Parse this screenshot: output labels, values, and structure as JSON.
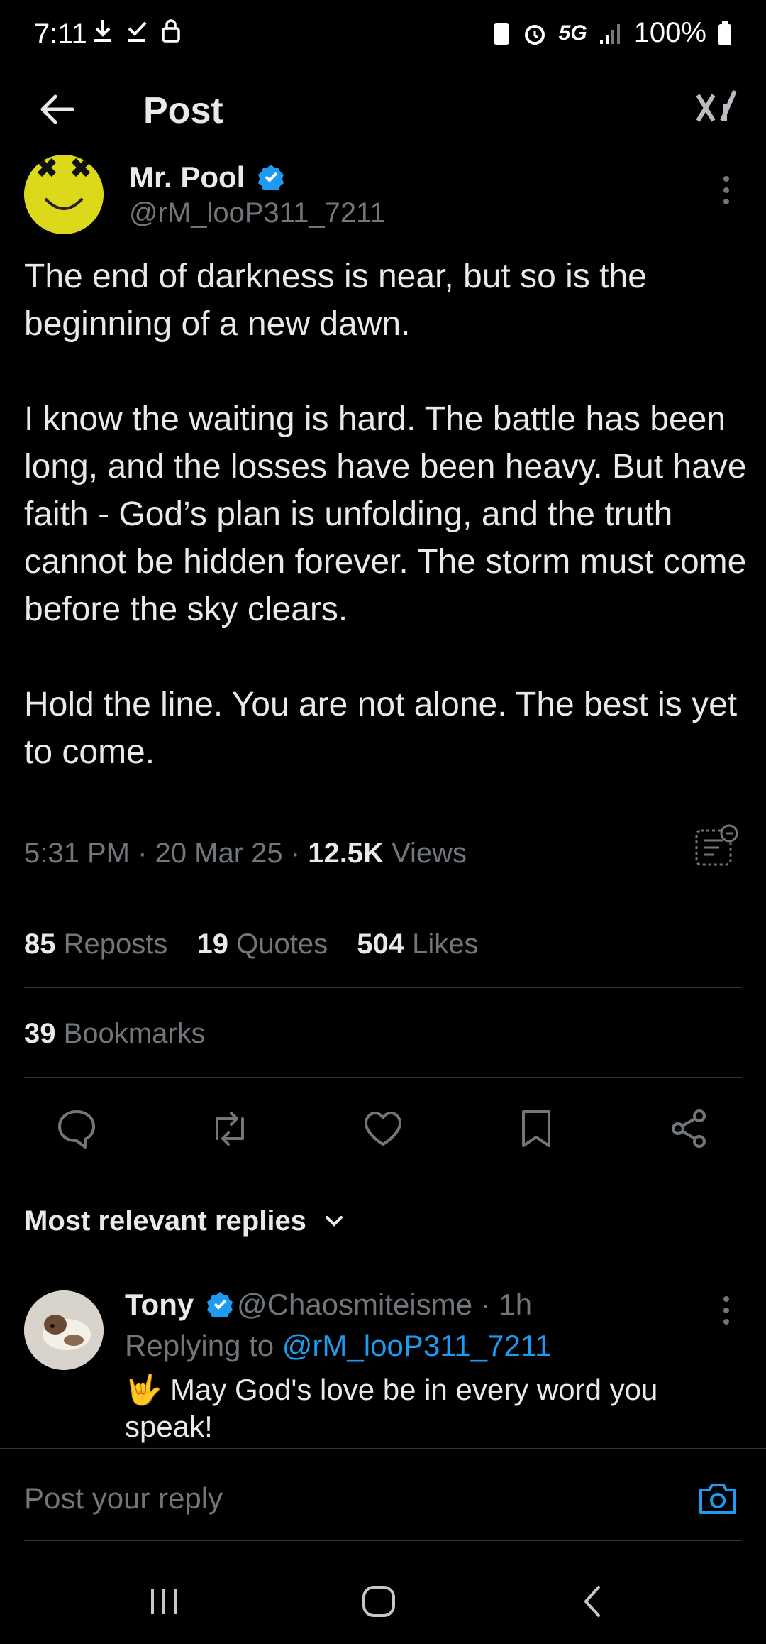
{
  "status_bar": {
    "time": "7:11",
    "network": "5G",
    "battery": "100%"
  },
  "header": {
    "title": "Post"
  },
  "post": {
    "author_name": "Mr. Pool",
    "author_handle": "@rM_looP311_7211",
    "paragraphs": [
      "The end of darkness is near, but so is the beginning of a new dawn.",
      "I know the waiting is hard. The battle has been long, and the losses have been heavy. But have faith - God’s plan is unfolding, and the truth cannot be hidden forever. The storm must come before the sky clears.",
      "Hold the line. You are not alone. The best is yet to come."
    ],
    "time": "5:31 PM",
    "date": "20 Mar 25",
    "views_count": "12.5K",
    "views_label": "Views",
    "reposts_count": "85",
    "reposts_label": "Reposts",
    "quotes_count": "19",
    "quotes_label": "Quotes",
    "likes_count": "504",
    "likes_label": "Likes",
    "bookmarks_count": "39",
    "bookmarks_label": "Bookmarks"
  },
  "replies": {
    "sort_label": "Most relevant replies",
    "items": [
      {
        "name": "Tony",
        "handle": "@Chaosmiteisme",
        "time": "1h",
        "replying_label": "Replying to",
        "replying_to": "@rM_looP311_7211",
        "emoji": "🤟",
        "text": "May God's love be in every word you speak!"
      }
    ]
  },
  "composer": {
    "placeholder": "Post your reply"
  },
  "colors": {
    "background": "#000000",
    "text": "#e7e9ea",
    "muted": "#71767b",
    "accent": "#1d9bf0",
    "divider": "#2f3336"
  }
}
